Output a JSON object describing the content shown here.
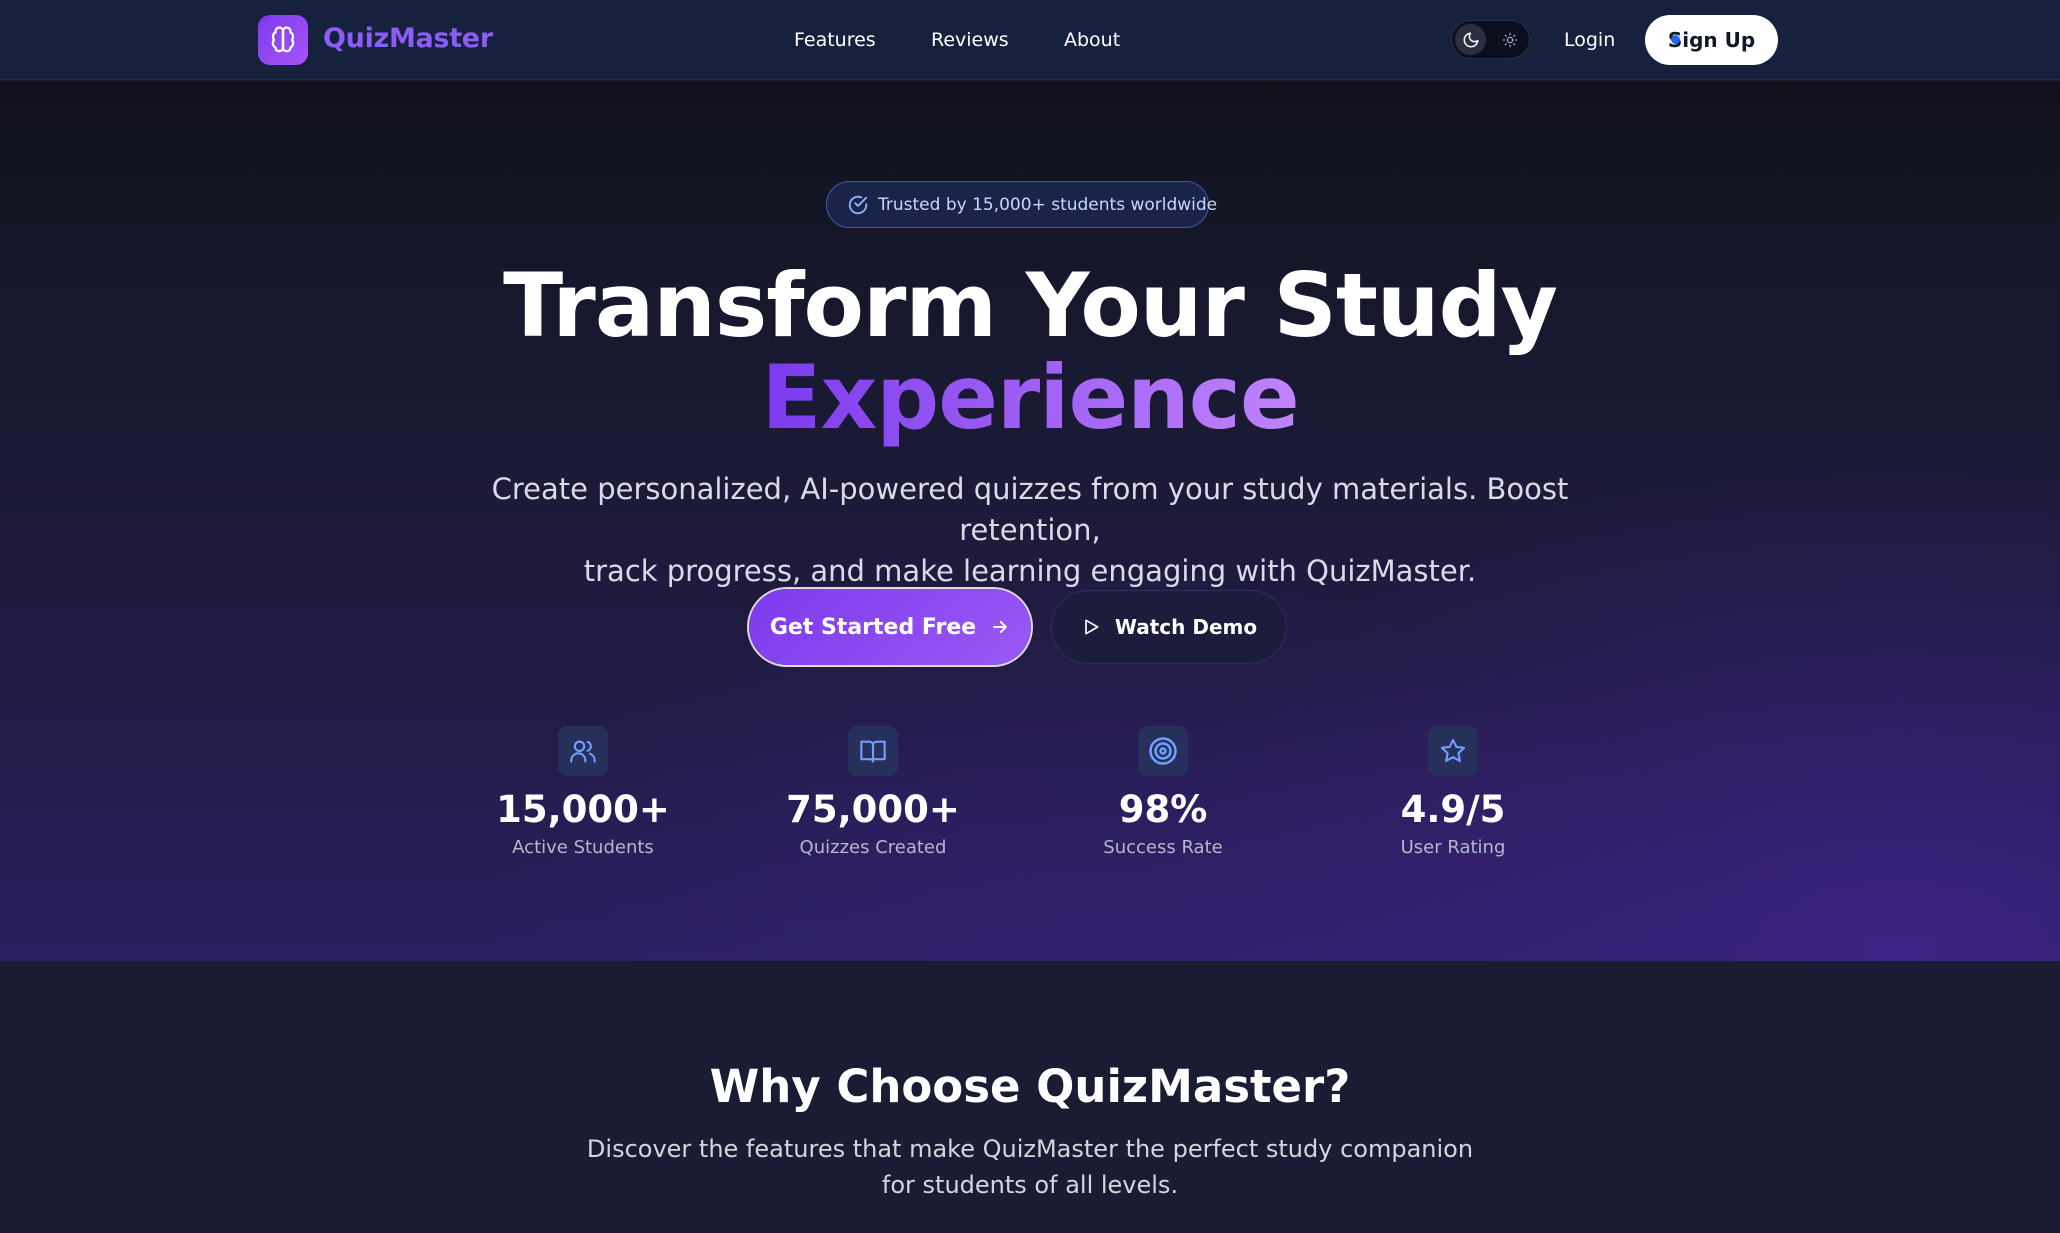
{
  "brand": {
    "name": "QuizMaster",
    "logo_icon": "brain-icon",
    "accent": "#8b5cf6"
  },
  "nav": {
    "links": [
      "Features",
      "Reviews",
      "About"
    ],
    "theme_toggle": {
      "dark_icon": "moon-icon",
      "light_icon": "sun-icon",
      "selected": "dark"
    },
    "login": "Login",
    "signup": "Sign Up"
  },
  "hero": {
    "badge": "Trusted by 15,000+ students worldwide",
    "title_line1": "Transform Your Study",
    "title_line2": "Experience",
    "subtitle_line1": "Create personalized, AI-powered quizzes from your study materials. Boost retention,",
    "subtitle_line2": "track progress, and make learning engaging with QuizMaster.",
    "cta_primary": "Get Started Free",
    "cta_secondary": "Watch Demo"
  },
  "stats": [
    {
      "value": "15,000+",
      "label": "Active Students",
      "icon": "users-icon"
    },
    {
      "value": "75,000+",
      "label": "Quizzes Created",
      "icon": "book-open-icon"
    },
    {
      "value": "98%",
      "label": "Success Rate",
      "icon": "target-icon"
    },
    {
      "value": "4.9/5",
      "label": "User Rating",
      "icon": "star-icon"
    }
  ],
  "features": {
    "title": "Why Choose QuizMaster?",
    "subtitle_line1": "Discover the features that make QuizMaster the perfect study companion",
    "subtitle_line2": "for students of all levels."
  }
}
